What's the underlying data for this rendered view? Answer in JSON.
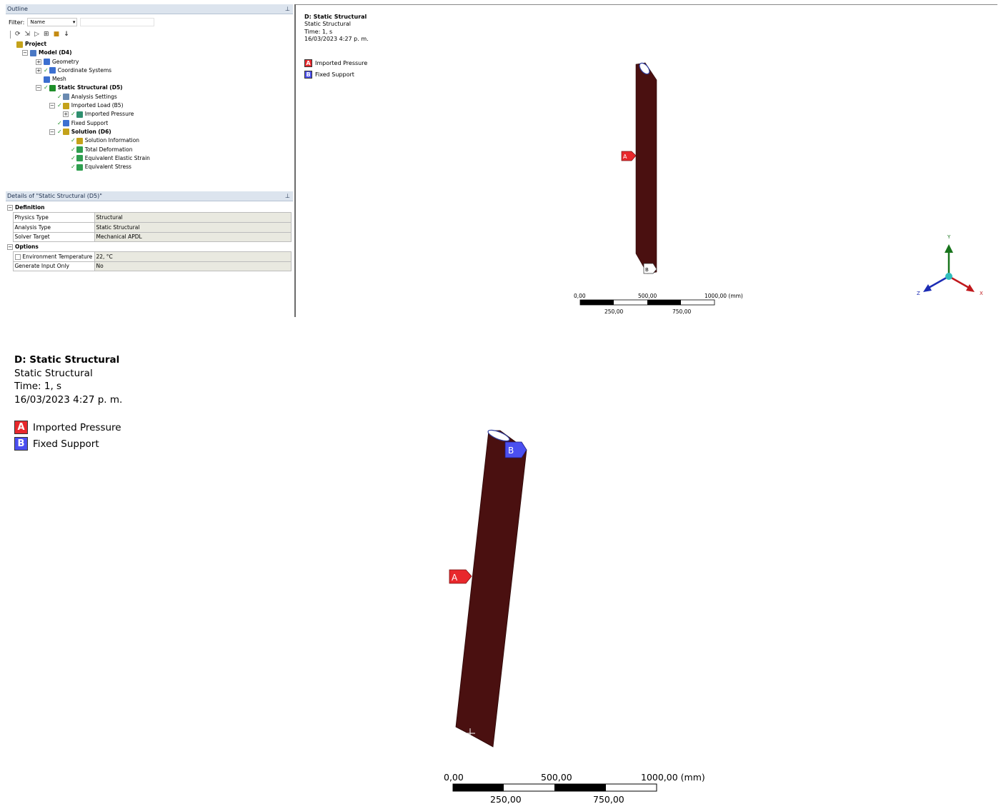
{
  "outline": {
    "title": "Outline",
    "filter_label": "Filter:",
    "filter_value": "Name",
    "tree": [
      {
        "label": "Project",
        "bold": true,
        "indent": 0,
        "icon": "project-icon",
        "expander": "",
        "check": false
      },
      {
        "label": "Model (D4)",
        "bold": true,
        "indent": 1,
        "icon": "model-icon",
        "expander": "−",
        "check": false
      },
      {
        "label": "Geometry",
        "bold": false,
        "indent": 2,
        "icon": "geometry-icon",
        "expander": "+",
        "check": false
      },
      {
        "label": "Coordinate Systems",
        "bold": false,
        "indent": 2,
        "icon": "coordinate-systems-icon",
        "expander": "+",
        "check": true
      },
      {
        "label": "Mesh",
        "bold": false,
        "indent": 2,
        "icon": "mesh-icon",
        "expander": "",
        "check": false
      },
      {
        "label": "Static Structural (D5)",
        "bold": true,
        "indent": 2,
        "icon": "analysis-icon",
        "expander": "−",
        "check": true
      },
      {
        "label": "Analysis Settings",
        "bold": false,
        "indent": 3,
        "icon": "analysis-settings-icon",
        "expander": "",
        "check": true
      },
      {
        "label": "Imported Load (B5)",
        "bold": false,
        "indent": 3,
        "icon": "imported-load-icon",
        "expander": "−",
        "check": true
      },
      {
        "label": "Imported Pressure",
        "bold": false,
        "indent": 4,
        "icon": "imported-pressure-icon",
        "expander": "+",
        "check": true
      },
      {
        "label": "Fixed Support",
        "bold": false,
        "indent": 3,
        "icon": "fixed-support-icon",
        "expander": "",
        "check": true
      },
      {
        "label": "Solution (D6)",
        "bold": true,
        "indent": 3,
        "icon": "solution-icon",
        "expander": "−",
        "check": true
      },
      {
        "label": "Solution Information",
        "bold": false,
        "indent": 4,
        "icon": "solution-information-icon",
        "expander": "",
        "check": true
      },
      {
        "label": "Total Deformation",
        "bold": false,
        "indent": 4,
        "icon": "result-icon",
        "expander": "",
        "check": true
      },
      {
        "label": "Equivalent Elastic Strain",
        "bold": false,
        "indent": 4,
        "icon": "result-icon",
        "expander": "",
        "check": true
      },
      {
        "label": "Equivalent Stress",
        "bold": false,
        "indent": 4,
        "icon": "result-icon",
        "expander": "",
        "check": true
      }
    ]
  },
  "details": {
    "title": "Details of \"Static Structural (D5)\"",
    "sections": [
      {
        "name": "Definition",
        "rows": [
          {
            "name": "Physics Type",
            "value": "Structural",
            "checkbox": false
          },
          {
            "name": "Analysis Type",
            "value": "Static Structural",
            "checkbox": false
          },
          {
            "name": "Solver Target",
            "value": "Mechanical APDL",
            "checkbox": false
          }
        ]
      },
      {
        "name": "Options",
        "rows": [
          {
            "name": "Environment Temperature",
            "value": "22, °C",
            "checkbox": true
          },
          {
            "name": "Generate Input Only",
            "value": "No",
            "checkbox": false
          }
        ]
      }
    ]
  },
  "viewport": {
    "title": "D: Static Structural",
    "subtitle": "Static Structural",
    "time": "Time: 1, s",
    "date": "16/03/2023 4:27 p. m.",
    "legend": [
      {
        "letter": "A",
        "label": "Imported Pressure",
        "color": "#e8282c"
      },
      {
        "letter": "B",
        "label": "Fixed Support",
        "color": "#4b4ff0"
      }
    ],
    "scale": {
      "top": [
        "0,00",
        "500,00",
        "1000,00 (mm)"
      ],
      "bottom": [
        "250,00",
        "750,00"
      ]
    },
    "triad": {
      "x": "X",
      "y": "Y",
      "z": "Z"
    }
  },
  "colors": {
    "body": "#4a1010",
    "triad_x": "#c0181c",
    "triad_y": "#18741c",
    "triad_z": "#1c2cb4",
    "triad_origin": "#2fbdbd"
  }
}
